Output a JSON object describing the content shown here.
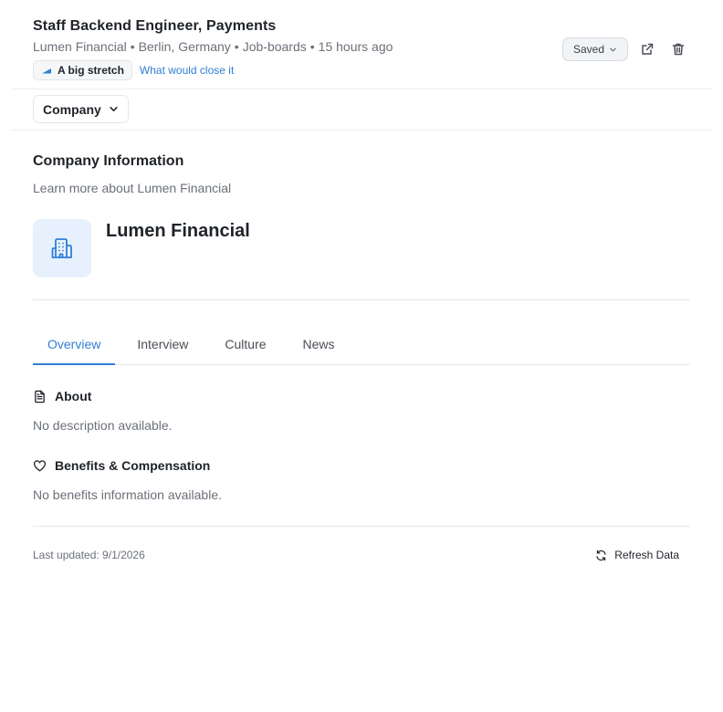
{
  "job": {
    "title": "Staff Backend Engineer, Payments",
    "company": "Lumen Financial",
    "location": "Berlin, Germany",
    "source": "Job-boards",
    "posted": "15 hours ago",
    "separator": "•",
    "fit_badge": "A big stretch",
    "fit_link": "What would close it"
  },
  "actions": {
    "saved_label": "Saved",
    "icons": [
      "chevron-down-icon",
      "external-link-icon",
      "trash-icon"
    ]
  },
  "section_dropdown": {
    "label": "Company"
  },
  "company_info": {
    "title": "Company Information",
    "subtitle": "Learn more about Lumen Financial",
    "name": "Lumen Financial",
    "logo_icon": "building-icon"
  },
  "tabs": [
    {
      "label": "Overview",
      "active": true
    },
    {
      "label": "Interview",
      "active": false
    },
    {
      "label": "Culture",
      "active": false
    },
    {
      "label": "News",
      "active": false
    }
  ],
  "about": {
    "title": "About",
    "text": "No description available.",
    "icon": "document-icon"
  },
  "benefits": {
    "title": "Benefits & Compensation",
    "text": "No benefits information available.",
    "icon": "heart-icon"
  },
  "footer": {
    "last_updated": "Last updated: 9/1/2026",
    "refresh_label": "Refresh Data",
    "icon": "refresh-icon"
  },
  "colors": {
    "accent": "#2f7fd6",
    "logo_bg": "#e7f1fd",
    "text_primary": "#1f2328",
    "text_muted": "#6b7078"
  }
}
